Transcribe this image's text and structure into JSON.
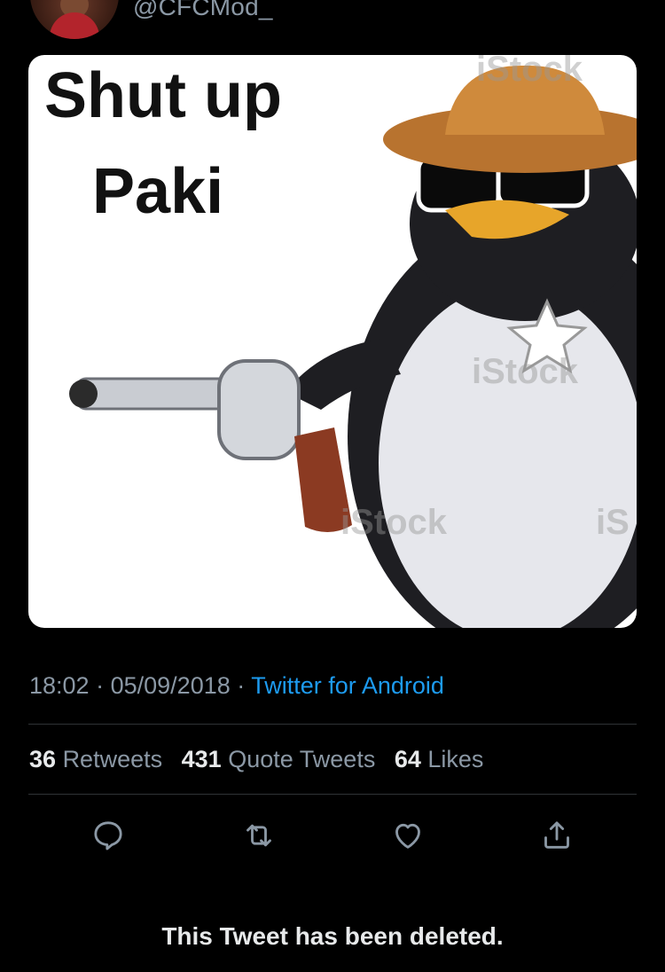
{
  "tweet": {
    "handle": "@CFCMod_",
    "meme_text_line_1": "Shut up",
    "meme_text_line_2": "Paki",
    "watermarks": [
      "iStock",
      "iStock",
      "iStock",
      "iS"
    ],
    "time": "18:02",
    "separator": "·",
    "date": "05/09/2018",
    "source": "Twitter for Android"
  },
  "stats": {
    "retweets_count": "36",
    "retweets_label": "Retweets",
    "quotes_count": "431",
    "quotes_label": "Quote Tweets",
    "likes_count": "64",
    "likes_label": "Likes"
  },
  "actions": {
    "icons": [
      "reply-icon",
      "retweet-icon",
      "like-icon",
      "share-icon"
    ]
  },
  "notice": {
    "deleted_text": "This Tweet has been deleted."
  },
  "colors": {
    "background": "#000000",
    "text_primary": "#e7e9ea",
    "text_secondary": "#8b98a5",
    "link": "#1d9bf0",
    "divider": "#2f3336"
  }
}
